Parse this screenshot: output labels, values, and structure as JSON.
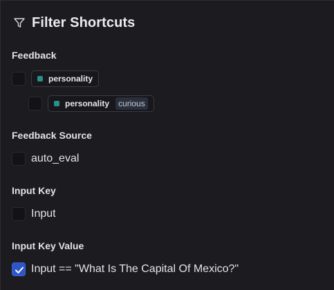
{
  "header": {
    "title": "Filter Shortcuts",
    "icon": "filter-icon"
  },
  "sections": {
    "feedback": {
      "label": "Feedback",
      "items": [
        {
          "key": "personality",
          "checked": false
        },
        {
          "key": "personality",
          "value": "curious",
          "checked": false
        }
      ]
    },
    "feedback_source": {
      "label": "Feedback Source",
      "items": [
        {
          "label": "auto_eval",
          "checked": false
        }
      ]
    },
    "input_key": {
      "label": "Input Key",
      "items": [
        {
          "label": "Input",
          "checked": false
        }
      ]
    },
    "input_key_value": {
      "label": "Input Key Value",
      "items": [
        {
          "label": "Input == \"What Is The Capital Of Mexico?\"",
          "checked": true
        }
      ]
    }
  },
  "colors": {
    "background": "#1c1b1f",
    "checkbox_checked": "#2f55c8",
    "chip_dot": "#2a8f8a",
    "value_tag_bg": "#2a2f3d"
  }
}
